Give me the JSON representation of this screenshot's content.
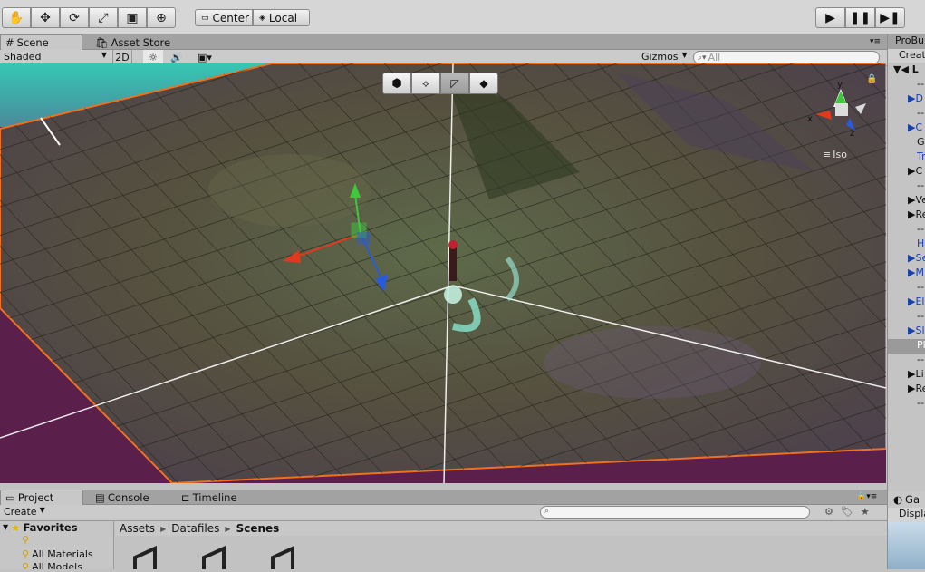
{
  "toolbar": {
    "tools": [
      "hand-icon",
      "move-icon",
      "rotate-icon",
      "scale-icon",
      "rect-icon",
      "transform-icon"
    ],
    "pivot_center": "Center",
    "pivot_local": "Local",
    "play_controls": [
      "play-icon",
      "pause-icon",
      "step-icon"
    ]
  },
  "scene_panel": {
    "tabs": [
      "Scene",
      "Asset Store"
    ],
    "shading_mode": "Shaded",
    "mode_2d": "2D",
    "gizmos_label": "Gizmos",
    "search_placeholder": "All",
    "iso_label": "Iso",
    "axis_x": "x",
    "axis_y": "y",
    "axis_z": "z"
  },
  "right_panel": {
    "tab": "ProBu",
    "create": "Creat",
    "items": [
      "L",
      "--",
      "D",
      "--",
      "C",
      "G",
      "Tr",
      "C",
      "--",
      "Ve",
      "Re",
      "--",
      "He",
      "Se",
      "M",
      "--",
      "El",
      "--",
      "Sl",
      "Pl",
      "--",
      "Li",
      "Re",
      "--"
    ],
    "game_tab": "Ga",
    "display": "Displa"
  },
  "project_panel": {
    "tabs": [
      "Project",
      "Console",
      "Timeline"
    ],
    "create_label": "Create",
    "favorites_label": "Favorites",
    "favorites": [
      "All Materials",
      "All Models"
    ],
    "breadcrumb": [
      "Assets",
      "Datafiles",
      "Scenes"
    ]
  },
  "colors": {
    "selection_outline": "#f07020",
    "background_purple": "#5a1f4b",
    "gizmo_green": "#3ec83e",
    "gizmo_red": "#e03a1e",
    "gizmo_blue": "#2a5adc"
  }
}
